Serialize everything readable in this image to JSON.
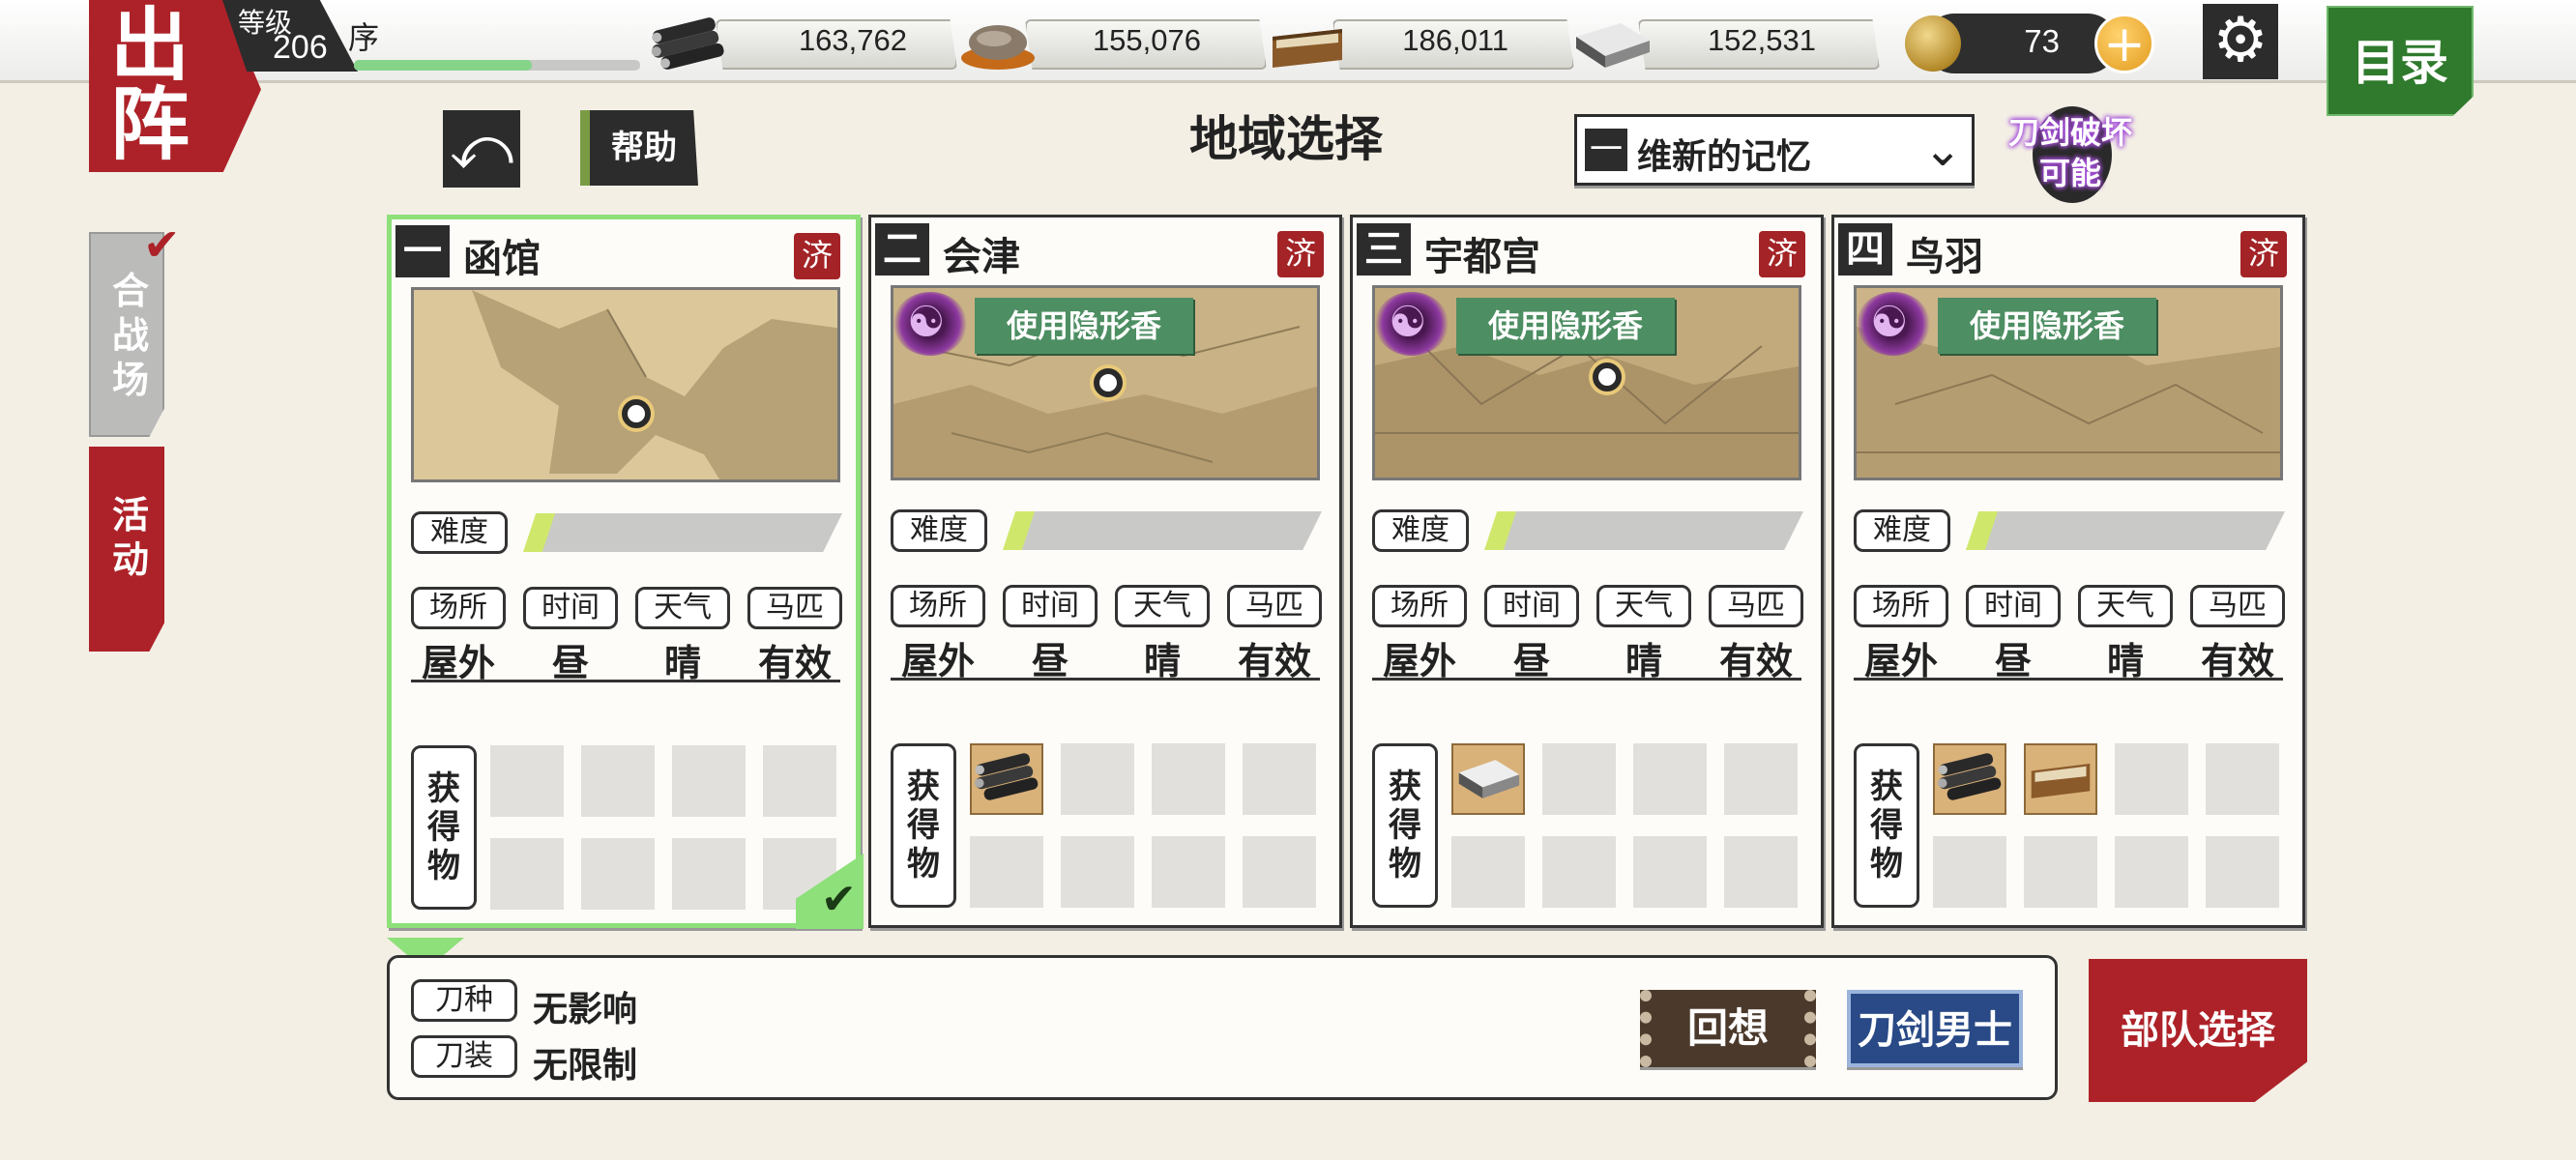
{
  "header": {
    "sortie_label_1": "出",
    "sortie_label_2": "阵",
    "level_label": "等级",
    "level_value": "206",
    "chapter": "序",
    "xp_progress": 0.62,
    "resources": [
      {
        "icon": "charcoal-icon",
        "value": "163,762"
      },
      {
        "icon": "jewel-steel-icon",
        "value": "155,076"
      },
      {
        "icon": "cooling-material-icon",
        "value": "186,011"
      },
      {
        "icon": "whetstone-icon",
        "value": "152,531"
      }
    ],
    "coins": "73",
    "plus": "+",
    "settings_glyph": "⚙",
    "menu_label": "目录"
  },
  "subheader": {
    "back_glyph": "⤺",
    "help_label": "帮助",
    "title": "地域选择",
    "era_select": {
      "number": "一",
      "value": "维新的记忆",
      "chevron": "⌄"
    },
    "sword_break": "刀剑破坏可能",
    "sword_break_line1": "刀剑破坏",
    "sword_break_line2": "可能"
  },
  "side_tabs": {
    "battle_label": "合战场",
    "event_label": "活动",
    "check": "✔"
  },
  "labels": {
    "difficulty": "难度",
    "place": "场所",
    "time": "时间",
    "weather": "天气",
    "horse": "马匹",
    "drops": "获得物",
    "cleared": "济",
    "incense": "使用隐形香"
  },
  "stages": [
    {
      "number": "一",
      "name": "函馆",
      "place": "屋外",
      "time": "昼",
      "weather": "晴",
      "horse": "有效",
      "selected": true,
      "incense": false,
      "difficulty": 0.1,
      "drops": []
    },
    {
      "number": "二",
      "name": "会津",
      "place": "屋外",
      "time": "昼",
      "weather": "晴",
      "horse": "有效",
      "selected": false,
      "incense": true,
      "difficulty": 0.1,
      "drops": [
        "charcoal-icon"
      ]
    },
    {
      "number": "三",
      "name": "宇都宫",
      "place": "屋外",
      "time": "昼",
      "weather": "晴",
      "horse": "有效",
      "selected": false,
      "incense": true,
      "difficulty": 0.1,
      "drops": [
        "whetstone-icon"
      ]
    },
    {
      "number": "四",
      "name": "鸟羽",
      "place": "屋外",
      "time": "昼",
      "weather": "晴",
      "horse": "有效",
      "selected": false,
      "incense": true,
      "difficulty": 0.1,
      "drops": [
        "charcoal-icon",
        "cooling-material-icon"
      ]
    }
  ],
  "restrictions": {
    "sword_type_label": "刀种",
    "sword_type_value": "无影响",
    "equip_label": "刀装",
    "equip_value": "无限制"
  },
  "buttons": {
    "recall": "回想",
    "touken": "刀剑男士",
    "squad_select": "部队选择"
  },
  "colors": {
    "brand_red": "#ad2228",
    "selected_green": "#8ee07a",
    "menu_green": "#2f7a2d",
    "incense_green": "#4d8e62",
    "touken_blue": "#294a86"
  }
}
